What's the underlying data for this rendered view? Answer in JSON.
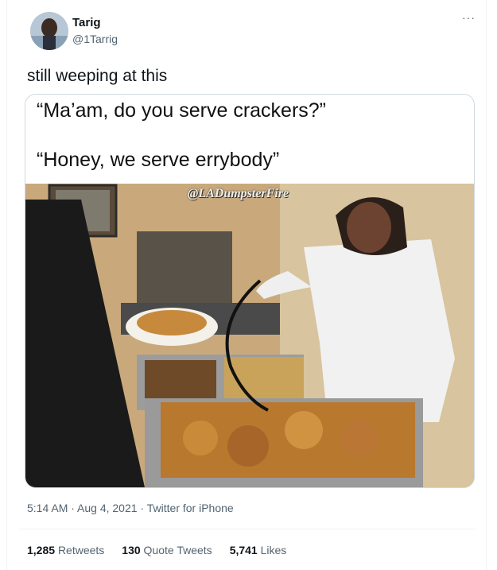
{
  "tweet": {
    "author": {
      "display_name": "Tarig",
      "handle": "@1Tarrig"
    },
    "more_icon": "more-horizontal-icon",
    "text": "still weeping at this",
    "media": {
      "caption_line_1": "“Ma’am, do you serve crackers?”",
      "caption_line_2": "“Honey, we serve errybody”",
      "watermark": "@LADumpsterFire"
    },
    "timestamp": "5:14 AM · Aug 4, 2021",
    "separator": " · ",
    "source": "Twitter for iPhone",
    "stats": {
      "retweets_count": "1,285",
      "retweets_label": "Retweets",
      "quotes_count": "130",
      "quotes_label": "Quote Tweets",
      "likes_count": "5,741",
      "likes_label": "Likes"
    }
  },
  "colors": {
    "text": "#0f1419",
    "secondary": "#536471",
    "border": "#cfd9de"
  }
}
